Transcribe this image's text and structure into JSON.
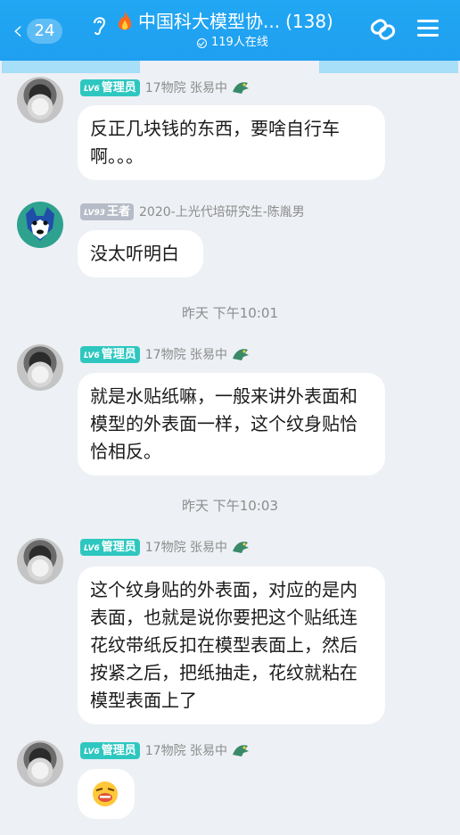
{
  "header": {
    "back_count": "24",
    "title": "中国科大模型协...",
    "member_count": "(138)",
    "online_text": "119人在线"
  },
  "messages": [
    {
      "badge_level": "LV6",
      "badge_title": "管理员",
      "sender": "17物院 张易中",
      "text": "反正几块钱的东西，要啥自行车啊。。。"
    },
    {
      "badge_level": "LV93",
      "badge_title": "王者",
      "sender": "2020-上光代培研究生-陈胤男",
      "text": "没太听明白"
    },
    {
      "badge_level": "LV6",
      "badge_title": "管理员",
      "sender": "17物院 张易中",
      "text": "就是水贴纸嘛，一般来讲外表面和模型的外表面一样，这个纹身贴恰恰相反。"
    },
    {
      "badge_level": "LV6",
      "badge_title": "管理员",
      "sender": "17物院 张易中",
      "text": "这个纹身贴的外表面，对应的是内表面，也就是说你要把这个贴纸连花纹带纸反扣在模型表面上，然后按紧之后，把纸抽走，花纹就粘在模型表面上了"
    },
    {
      "badge_level": "LV6",
      "badge_title": "管理员",
      "sender": "17物院 张易中",
      "emoji": "grimace-emoji"
    }
  ],
  "timestamps": [
    "昨天 下午10:01",
    "昨天 下午10:03"
  ],
  "colors": {
    "header": "#21a7f3",
    "admin_badge": "#2ec7c0",
    "king_badge": "#b6bcc7",
    "background": "#edf0f4"
  }
}
